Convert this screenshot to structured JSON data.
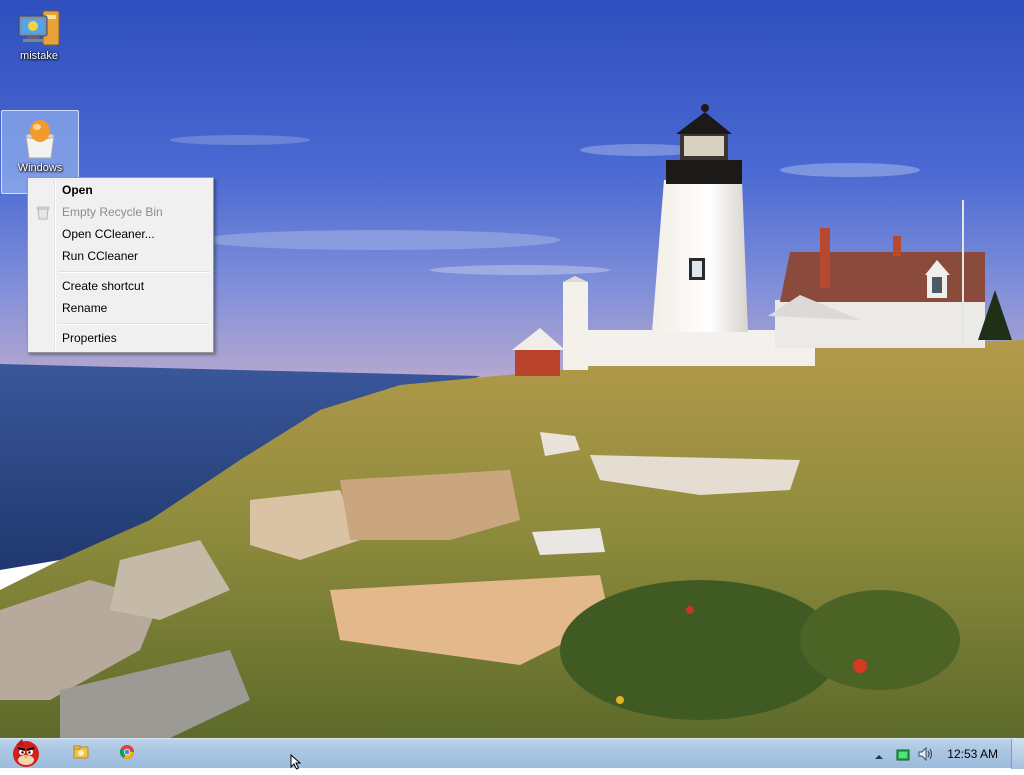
{
  "desktop": {
    "icons": [
      {
        "label": "mistake",
        "icon": "computer-folder-icon"
      },
      {
        "label": "Windows",
        "icon": "ccleaner-recycle-bin-icon"
      }
    ]
  },
  "context_menu": {
    "items": [
      {
        "label": "Open",
        "bold": true,
        "disabled": false
      },
      {
        "label": "Empty Recycle Bin",
        "bold": false,
        "disabled": true
      },
      {
        "label": "Open CCleaner...",
        "bold": false,
        "disabled": false
      },
      {
        "label": "Run CCleaner",
        "bold": false,
        "disabled": false
      },
      {
        "label": "Create shortcut",
        "bold": false,
        "disabled": false
      },
      {
        "label": "Rename",
        "bold": false,
        "disabled": false
      },
      {
        "label": "Properties",
        "bold": false,
        "disabled": false
      }
    ]
  },
  "taskbar": {
    "pinned": [
      "angry-birds-start-icon",
      "explorer-folder-icon",
      "chrome-icon"
    ],
    "tray": {
      "icons": [
        "show-hidden-icons-arrow",
        "battery-icon",
        "volume-icon"
      ],
      "clock": "12:53 AM"
    }
  },
  "colors": {
    "taskbar": "#a9c5e2",
    "menu_bg": "#f0f0f0",
    "sky": "#3f5ec4",
    "sea": "#2b4a8c"
  }
}
